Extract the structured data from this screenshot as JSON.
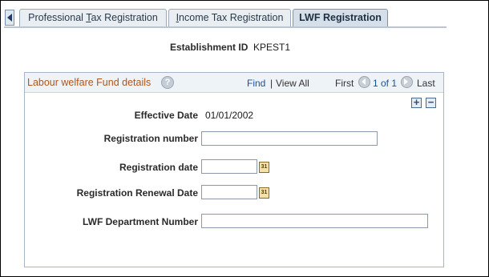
{
  "tabs": {
    "items": [
      {
        "label": "Professional Tax Registration",
        "mnemonic_prefix": "Professional ",
        "mnemonic_letter": "T",
        "mnemonic_suffix": "ax Registration"
      },
      {
        "label": "Income Tax Registration",
        "mnemonic_prefix": "",
        "mnemonic_letter": "I",
        "mnemonic_suffix": "ncome Tax Registration"
      },
      {
        "label": "LWF Registration"
      }
    ]
  },
  "header": {
    "establishment_label": "Establishment ID",
    "establishment_value": "KPEST1"
  },
  "group": {
    "title": "Labour welfare Fund details",
    "help": "?",
    "find": "Find",
    "separator": "|",
    "view_all": "View All",
    "first": "First",
    "page_info": "1 of 1",
    "last": "Last",
    "add": "+",
    "remove": "−"
  },
  "form": {
    "effective_date_label": "Effective Date",
    "effective_date_value": "01/01/2002",
    "registration_number_label": "Registration number",
    "registration_number_value": "",
    "registration_date_label": "Registration date",
    "registration_date_value": "",
    "renewal_date_label": "Registration Renewal Date",
    "renewal_date_value": "",
    "lwf_department_label": "LWF Department Number",
    "lwf_department_value": "",
    "calendar_glyph": "31"
  },
  "icons": {
    "tab_scroll_left": "triangle-left-icon",
    "help": "help-icon",
    "prev": "prev-arrow-icon",
    "next": "next-arrow-icon",
    "calendar": "calendar-icon"
  },
  "colors": {
    "group_title": "#b0561c",
    "link": "#1f4e9c",
    "active_tab_bg": "#d5dfea"
  }
}
